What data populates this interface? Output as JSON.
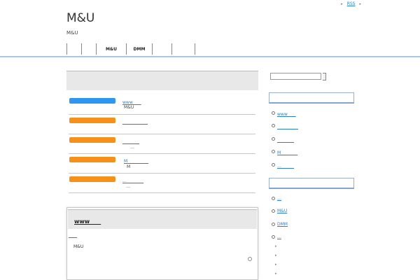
{
  "topbar": {
    "rss": "RSS",
    "arrow": "▸"
  },
  "site": {
    "title": "M&U",
    "description": "M&U"
  },
  "nav": [
    {
      "label": ""
    },
    {
      "label": ""
    },
    {
      "label": "M&U"
    },
    {
      "label": "DMM"
    },
    {
      "label": ""
    },
    {
      "label": ""
    }
  ],
  "news": [
    {
      "color": "#2f96ef",
      "title": "www　　",
      "sub": "M&U"
    },
    {
      "color": "#f79018",
      "title": "　　　　　　",
      "sub": ""
    },
    {
      "color": "#f79018",
      "title": "　　　　",
      "sub": "…"
    },
    {
      "color": "#f79018",
      "title": "M　　　　　",
      "sub": "M"
    },
    {
      "color": "#f79018",
      "title": "…　　　　",
      "sub": "…"
    }
  ],
  "box": {
    "title": "www　　",
    "link": "　　",
    "text": "M&U"
  },
  "sidebar": {
    "list1": [
      "www　　",
      "　　　　　",
      "　　　　",
      "M　　　　",
      "…　　　"
    ],
    "list2": [
      "…",
      "M&U",
      "DMM",
      "…"
    ],
    "sub": [
      "▸",
      "▸",
      "▸",
      "▸"
    ]
  }
}
